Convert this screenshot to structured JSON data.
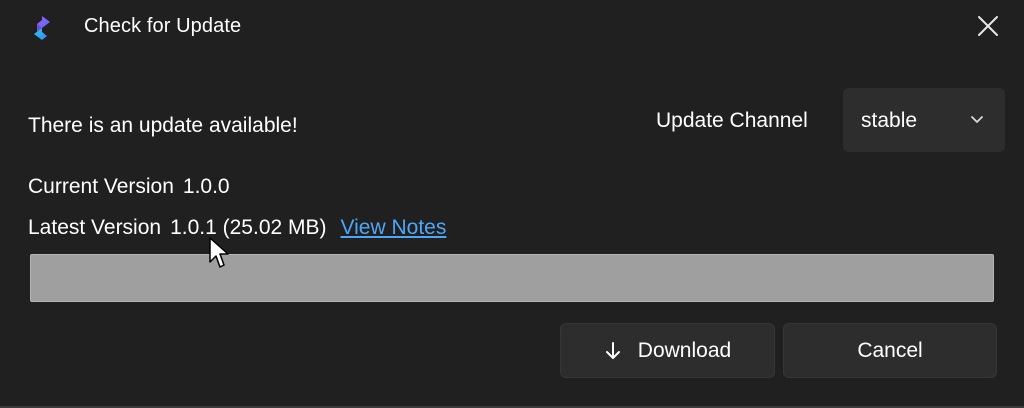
{
  "window": {
    "title": "Check for Update"
  },
  "update": {
    "message": "There is an update available!",
    "channel_label": "Update Channel",
    "channel_value": "stable",
    "current_label": "Current Version",
    "current_version": "1.0.0",
    "latest_label": "Latest Version",
    "latest_version": "1.0.1 (25.02 MB)",
    "view_notes": "View Notes",
    "progress_fraction": 0
  },
  "buttons": {
    "download": "Download",
    "cancel": "Cancel"
  },
  "icons": {
    "app": "app-logo-icon",
    "close": "close-icon",
    "chevron": "chevron-down-icon",
    "download": "arrow-down-icon",
    "cursor": "mouse-pointer-icon"
  },
  "colors": {
    "background": "#202020",
    "link": "#4ea6f5",
    "progress_track": "#9f9f9f",
    "button": "#2d2d2d"
  }
}
